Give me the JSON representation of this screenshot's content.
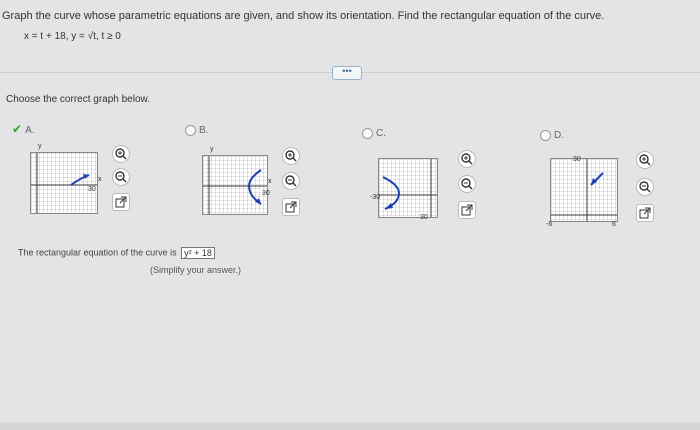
{
  "question": {
    "text": "Graph the curve whose parametric equations are given, and show its orientation. Find the rectangular equation of the curve.",
    "equation": "x = t + 18,  y = √t,  t ≥ 0"
  },
  "more_button": "•••",
  "prompt": "Choose the correct graph below.",
  "options": [
    {
      "letter": "A.",
      "selected": true
    },
    {
      "letter": "B.",
      "selected": false
    },
    {
      "letter": "C.",
      "selected": false
    },
    {
      "letter": "D.",
      "selected": false
    }
  ],
  "graph_labels": {
    "a_y": "y",
    "a_x": "x",
    "a_num": "30",
    "b_y": "y",
    "b_x": "x",
    "b_num": "30",
    "c_num_left": "-30",
    "c_num_bottom": "30",
    "d_top": "30",
    "d_left": "-6",
    "d_right": "6"
  },
  "answer": {
    "prefix": "The rectangular equation of the curve is",
    "value": "y² + 18",
    "hint": "(Simplify your answer.)"
  },
  "icons": [
    "zoom-in-icon",
    "zoom-out-icon",
    "external-link-icon"
  ],
  "colors": {
    "curve": "#1a3fb0",
    "check": "#3a9a3a",
    "grid": "#9a9a9a"
  }
}
